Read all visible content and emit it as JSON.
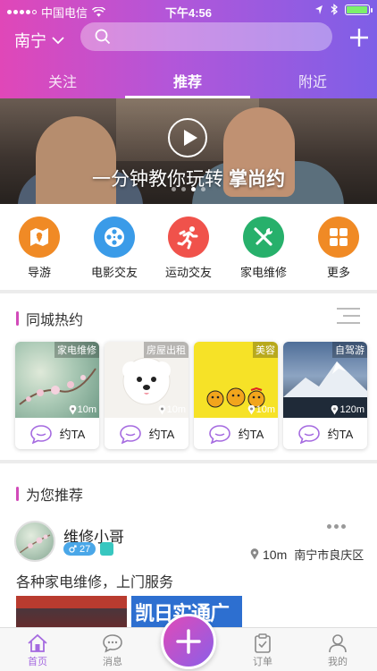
{
  "status_bar": {
    "carrier": "中国电信",
    "time": "下午4:56"
  },
  "header": {
    "city": "南宁",
    "search_placeholder": "",
    "tabs": [
      {
        "label": "关注"
      },
      {
        "label": "推荐"
      },
      {
        "label": "附近"
      }
    ],
    "active_tab": 1
  },
  "banner": {
    "caption": "一分钟教你玩转",
    "caption_bold": "掌尚约",
    "slide_count": 4,
    "active_slide": 2
  },
  "categories": [
    {
      "label": "导游",
      "icon": "map-icon",
      "color": "#f08a25"
    },
    {
      "label": "电影交友",
      "icon": "film-reel-icon",
      "color": "#3a9be8"
    },
    {
      "label": "运动交友",
      "icon": "running-icon",
      "color": "#f0524b"
    },
    {
      "label": "家电维修",
      "icon": "tools-icon",
      "color": "#27b06b"
    },
    {
      "label": "更多",
      "icon": "grid-icon",
      "color": "#f08a25"
    }
  ],
  "hot_section": {
    "title": "同城热约",
    "cards": [
      {
        "tag": "家电维修",
        "distance": "10m",
        "action": "约TA",
        "image": "blossom-branch"
      },
      {
        "tag": "房屋出租",
        "distance": "10m",
        "action": "约TA",
        "image": "white-puppy"
      },
      {
        "tag": "美容",
        "distance": "10m",
        "action": "约TA",
        "image": "yellow-ducks"
      },
      {
        "tag": "自驾游",
        "distance": "120m",
        "action": "约TA",
        "image": "snowy-mountain"
      }
    ]
  },
  "recommend_section": {
    "title": "为您推荐",
    "user": {
      "name": "维修小哥",
      "age": "27",
      "distance": "10m",
      "location": "南宁市良庆区"
    },
    "description": "各种家电维修，上门服务",
    "photo2_text": "凯日实通广"
  },
  "tab_bar": {
    "items": [
      {
        "label": "首页",
        "icon": "home-icon"
      },
      {
        "label": "消息",
        "icon": "chat-icon"
      },
      {
        "label": "订单",
        "icon": "order-icon"
      },
      {
        "label": "我的",
        "icon": "profile-icon"
      }
    ],
    "active": 0
  },
  "colors": {
    "accent": "#d24ab9",
    "gradient_start": "#e047b8",
    "gradient_end": "#7e5fe7"
  }
}
